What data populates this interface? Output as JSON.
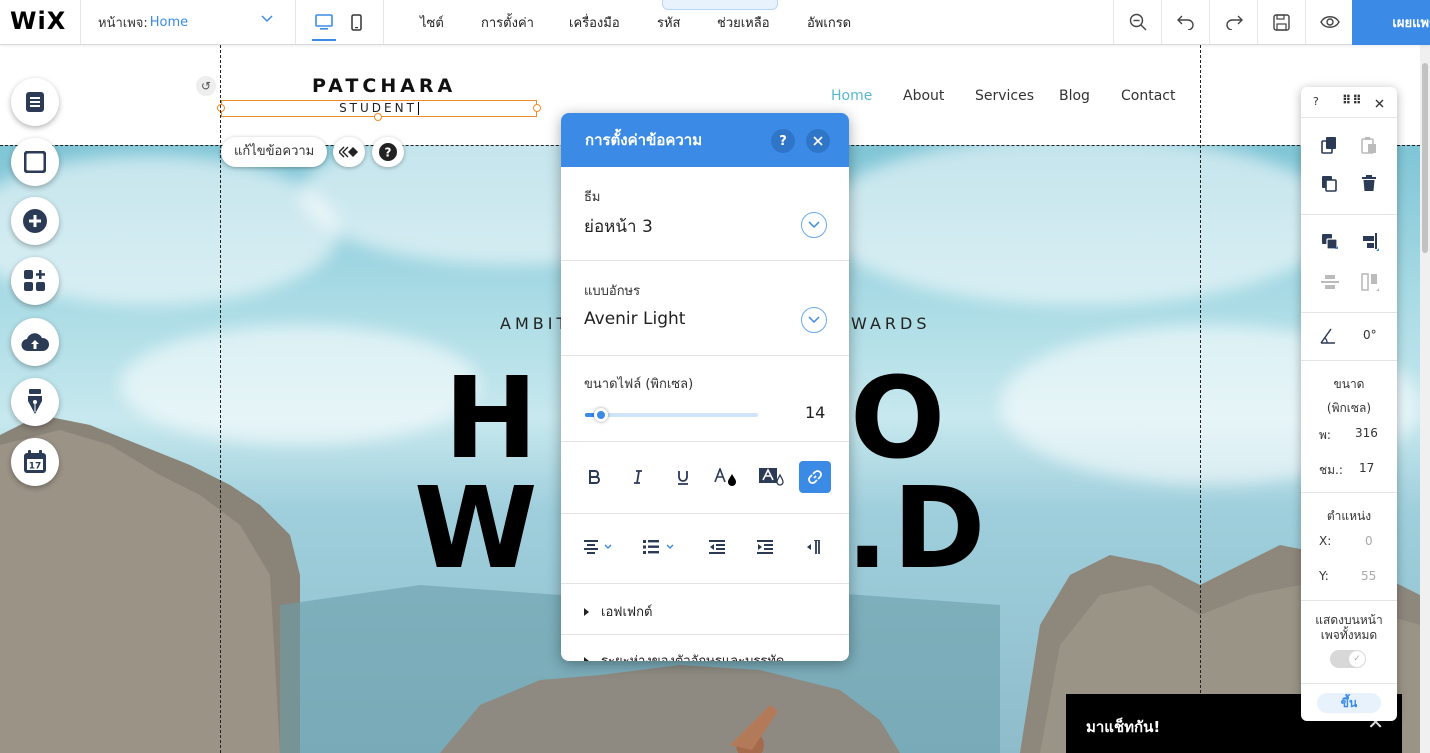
{
  "topbar": {
    "logo": "WiX",
    "page_label": "หน้าเพจ:",
    "page_value": "Home",
    "menu": [
      "ไซต์",
      "การตั้งค่า",
      "เครื่องมือ",
      "รหัส",
      "ช่วยเหลือ",
      "อัพเกรด"
    ],
    "publish": "เผยแพร่"
  },
  "site": {
    "title": "PATCHARA",
    "subtitle": "STUDENT",
    "nav": [
      "Home",
      "About",
      "Services",
      "Blog",
      "Contact"
    ],
    "active_nav": "Home",
    "hero_sub_left": "AMBIT",
    "hero_sub_right": "WARDS",
    "hero_line1_left": "H",
    "hero_line1_right": "O",
    "hero_line2_left": "W",
    "hero_line2_right": ".D"
  },
  "edit_bar": {
    "edit_text": "แก้ไขข้อความ"
  },
  "text_settings": {
    "title": "การตั้งค่าข้อความ",
    "help": "?",
    "theme_label": "ธีม",
    "theme_value": "ย่อหน้า 3",
    "font_label": "แบบอักษร",
    "font_value": "Avenir Light",
    "size_label": "ขนาดไฟล์ (พิกเซล)",
    "size_value": "14",
    "size_fraction": 0.09,
    "effects": "เอฟเฟกต์",
    "spacing": "ระยะห่างของตัวอักษรและบรรทัด"
  },
  "inspector": {
    "help": "?",
    "angle": "0°",
    "size_label_1": "ขนาด",
    "size_label_2": "(พิกเซล)",
    "w_label": "พ:",
    "w_value": "316",
    "h_label": "ชม.:",
    "h_value": "17",
    "pos_label": "ตำแหน่ง",
    "x_label": "X:",
    "x_value": "0",
    "y_label": "Y:",
    "y_value": "55",
    "show_all_1": "แสดงบนหน้า",
    "show_all_2": "เพจทั้งหมด",
    "up": "ขึ้น"
  },
  "chat": {
    "text": "มาแช็ทกัน!"
  },
  "colors": {
    "accent": "#3b8be6",
    "selection": "#f08c28"
  }
}
